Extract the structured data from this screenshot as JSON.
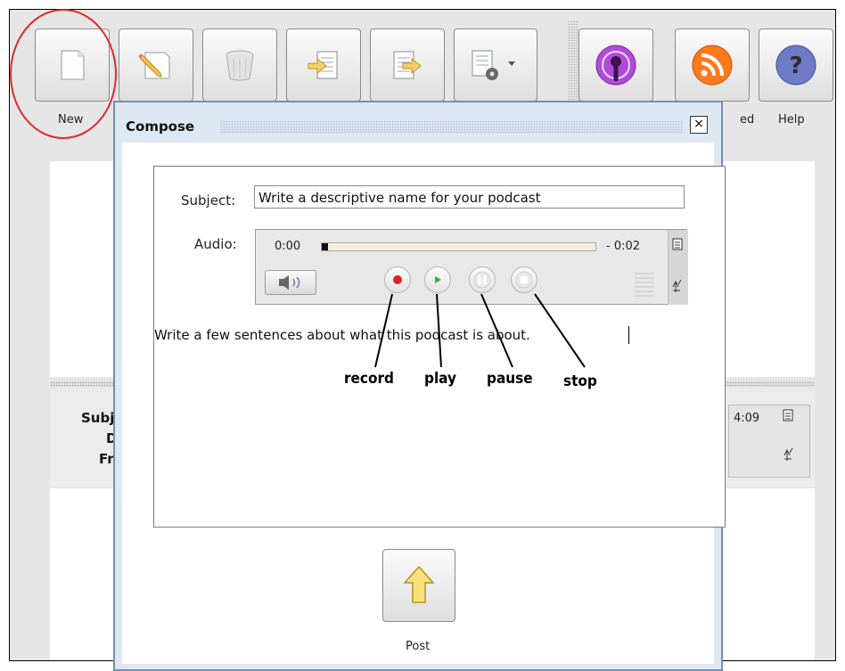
{
  "toolbar": {
    "buttons": [
      {
        "id": "new",
        "label": "New",
        "icon": "blank-document-icon"
      },
      {
        "id": "edit",
        "label": "",
        "icon": "pencil-document-icon"
      },
      {
        "id": "delete",
        "label": "",
        "icon": "trash-bin-icon"
      },
      {
        "id": "import",
        "label": "",
        "icon": "import-document-icon"
      },
      {
        "id": "export",
        "label": "",
        "icon": "export-document-icon"
      },
      {
        "id": "settings",
        "label": "",
        "icon": "settings-document-dropdown-icon"
      },
      {
        "id": "podcast",
        "label": "",
        "icon": "podcast-icon",
        "color": "#a23fd0"
      },
      {
        "id": "feed",
        "label": "ed",
        "icon": "rss-icon",
        "color": "#ff7a1a"
      },
      {
        "id": "help",
        "label": "Help",
        "icon": "help-icon",
        "color": "#6c79c4"
      }
    ]
  },
  "background_list": {
    "detail_labels": [
      "Subj",
      "Da",
      "Fr"
    ],
    "time": "4:09"
  },
  "dialog": {
    "title": "Compose",
    "close_icon": "close-icon",
    "subject_label": "Subject:",
    "subject_value": "Write a descriptive name for your podcast",
    "audio_label": "Audio:",
    "player": {
      "time_start": "0:00",
      "time_end": "- 0:02",
      "progress": 0.0
    },
    "description": "Write a few sentences about what this podcast is about.",
    "post_label": "Post"
  },
  "annotations": {
    "record": "record",
    "play": "play",
    "pause": "pause",
    "stop": "stop"
  },
  "colors": {
    "highlight_circle": "#e0292b",
    "dialog_border": "#6d8fc4",
    "record": "#e02020",
    "play": "#2fb52f"
  }
}
